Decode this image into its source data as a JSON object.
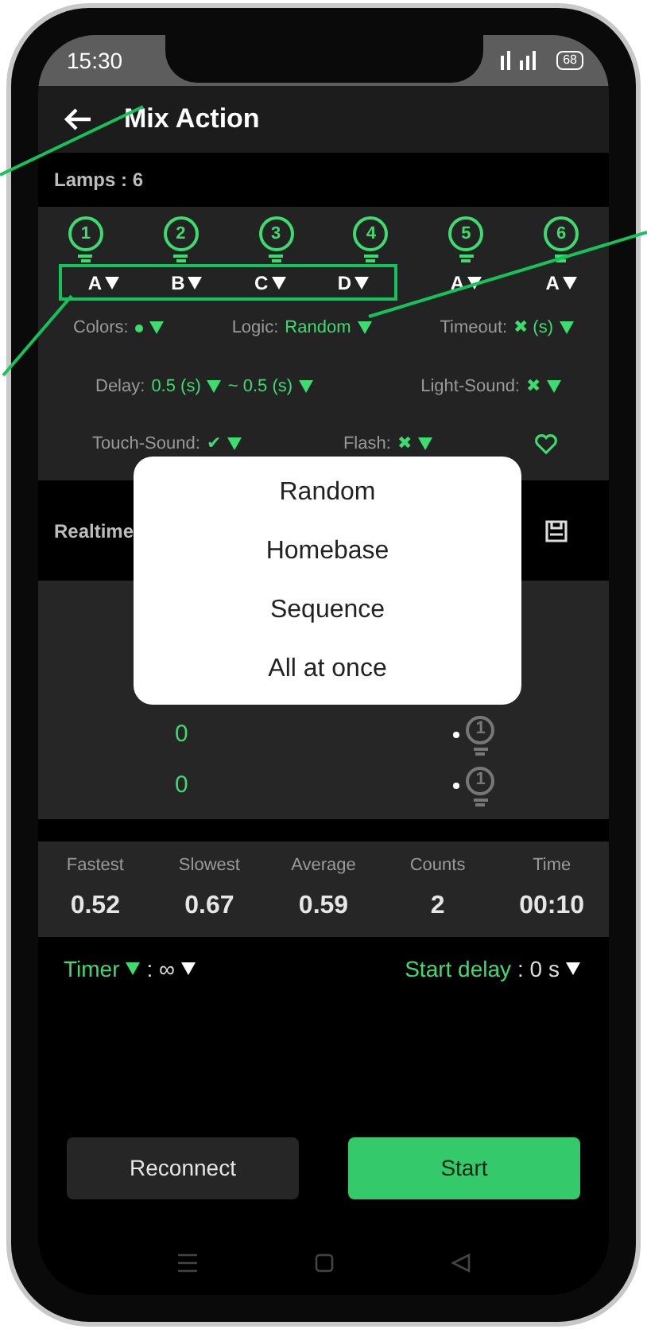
{
  "status_bar": {
    "time": "15:30",
    "battery": "68"
  },
  "header": {
    "title": "Mix Action"
  },
  "lamps_label": "Lamps : 6",
  "lamps": [
    {
      "number": "1",
      "group": "A"
    },
    {
      "number": "2",
      "group": "B"
    },
    {
      "number": "3",
      "group": "C"
    },
    {
      "number": "4",
      "group": "D"
    },
    {
      "number": "5",
      "group": "A"
    },
    {
      "number": "6",
      "group": "A"
    }
  ],
  "settings": [
    [
      {
        "label": "Colors:",
        "kind": "dot"
      },
      {
        "label": "Logic:",
        "kind": "text",
        "values": [
          "Random"
        ]
      },
      {
        "label": "Timeout:",
        "kind": "text",
        "values": [
          "✖ (s)"
        ]
      }
    ],
    [
      {
        "label": "Delay:",
        "kind": "text",
        "values": [
          "0.5 (s)",
          "~ 0.5 (s)"
        ]
      },
      {
        "label": "Light-Sound:",
        "kind": "text",
        "values": [
          "✖"
        ]
      }
    ],
    [
      {
        "label": "Touch-Sound:",
        "kind": "text",
        "values": [
          "✔"
        ]
      },
      {
        "label": "Flash:",
        "kind": "text",
        "values": [
          "✖"
        ]
      },
      {
        "kind": "heart"
      }
    ]
  ],
  "realtime": {
    "title": "Realtime",
    "rows": [
      {
        "value": "0",
        "lamp": "1"
      },
      {
        "value": "0",
        "lamp": "1"
      }
    ]
  },
  "stats": [
    {
      "label": "Fastest",
      "value": "0.52"
    },
    {
      "label": "Slowest",
      "value": "0.67"
    },
    {
      "label": "Average",
      "value": "0.59"
    },
    {
      "label": "Counts",
      "value": "2"
    },
    {
      "label": "Time",
      "value": "00:10"
    }
  ],
  "timer": {
    "label": "Timer",
    "value": ": ∞"
  },
  "start_delay": {
    "label": "Start delay",
    "value": ": 0 s"
  },
  "buttons": [
    {
      "label": "Reconnect",
      "kind": "secondary"
    },
    {
      "label": "Start",
      "kind": "primary"
    }
  ],
  "popup": {
    "options": [
      "Random",
      "Homebase",
      "Sequence",
      "All at once"
    ]
  }
}
